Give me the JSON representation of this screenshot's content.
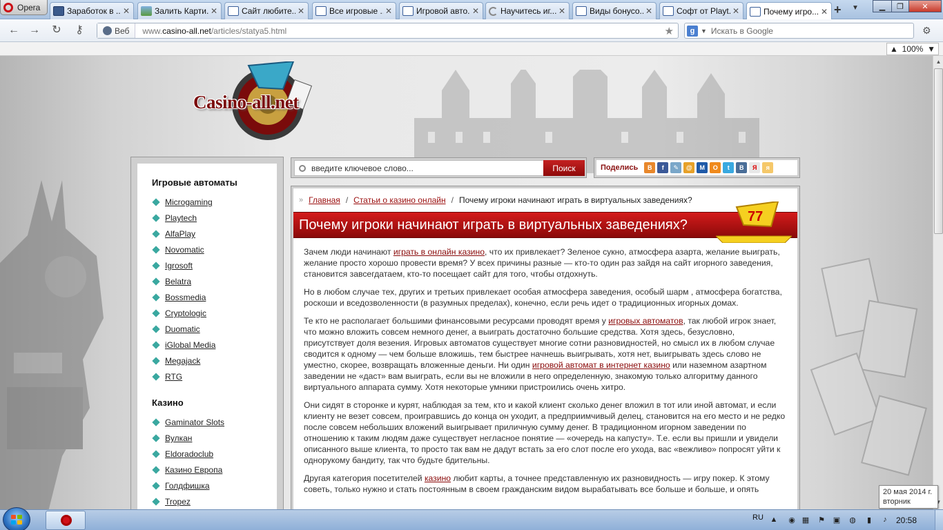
{
  "browser": {
    "menu_label": "Opera",
    "tabs": [
      {
        "title": "Заработок в ...",
        "fav": "mon"
      },
      {
        "title": "Залить Карти...",
        "fav": "img"
      },
      {
        "title": "Сайт любите...",
        "fav": "def"
      },
      {
        "title": "Все игровые ...",
        "fav": "def"
      },
      {
        "title": "Игровой авто...",
        "fav": "def"
      },
      {
        "title": "Научитесь иг...",
        "fav": "spin"
      },
      {
        "title": "Виды бонусо...",
        "fav": "def"
      },
      {
        "title": "Софт от Playt...",
        "fav": "def"
      },
      {
        "title": "Почему игро...",
        "fav": "def",
        "active": true
      }
    ],
    "address": {
      "mode_label": "Веб",
      "url_host": "www.casino-all.net",
      "url_prefix": "www.",
      "url_domain": "casino-all.net",
      "url_path": "/articles/statya5.html"
    },
    "search": {
      "engine_letter": "g",
      "placeholder": "Искать в Google"
    },
    "zoom": "100%"
  },
  "site": {
    "logo_text": "Casino-all.net",
    "search": {
      "placeholder": "введите ключевое слово...",
      "button": "Поиск"
    },
    "share": {
      "label": "Поделись",
      "icons": [
        {
          "name": "blogger-icon",
          "color": "#e8872b",
          "glyph": "B"
        },
        {
          "name": "facebook-icon",
          "color": "#3b5998",
          "glyph": "f"
        },
        {
          "name": "livejournal-icon",
          "color": "#7aa7c9",
          "glyph": "✎"
        },
        {
          "name": "mailru-icon",
          "color": "#e7a128",
          "glyph": "@"
        },
        {
          "name": "moimir-icon",
          "color": "#1f5aa8",
          "glyph": "М"
        },
        {
          "name": "odnoklassniki-icon",
          "color": "#f08a1c",
          "glyph": "О"
        },
        {
          "name": "twitter-icon",
          "color": "#39a9e0",
          "glyph": "t"
        },
        {
          "name": "vkontakte-icon",
          "color": "#4a6e98",
          "glyph": "В"
        },
        {
          "name": "yandex-icon",
          "color": "#e8e8e8",
          "glyph": "Я",
          "fg": "#d00"
        },
        {
          "name": "yaru-icon",
          "color": "#f5c86a",
          "glyph": "я"
        }
      ]
    },
    "sidebar": {
      "heading_slots": "Игровые автоматы",
      "slots": [
        "Microgaming",
        "Playtech",
        "AlfaPlay",
        "Novomatic",
        "Igrosoft",
        "Belatra",
        "Bossmedia",
        "Cryptologic",
        "Duomatic",
        "iGlobal Media",
        "Megajack",
        "RTG"
      ],
      "heading_casino": "Казино",
      "casino": [
        "Gaminator Slots",
        "Вулкан",
        "Eldoradoclub",
        "Казино Европа",
        "Голдфишка",
        "Tropez"
      ]
    },
    "article": {
      "crumbs": {
        "home": "Главная",
        "section": "Статьи о казино онлайн",
        "current": "Почему игроки начинают играть в виртуальных заведениях?"
      },
      "title": "Почему игроки начинают играть в виртуальных заведениях?",
      "p1a": "Зачем люди начинают ",
      "p1link": "играть в онлайн казино",
      "p1b": ", что их привлекает? Зеленое сукно, атмосфера азарта, желание выиграть, желание просто хорошо провести время? У всех причины разные — кто-то один раз зайдя на сайт игорного заведения, становится завсегдатаем, кто-то посещает сайт для того, чтобы отдохнуть.",
      "p2": "Но в любом случае тех, других и третьих привлекает особая атмосфера заведения, особый шарм , атмосфера богатства, роскоши и вседозволенности (в разумных пределах), конечно, если речь идет о традиционных игорных домах.",
      "p3a": "Те кто не располагает большими финансовыми ресурсами проводят время у ",
      "p3link1": "игровых автоматов",
      "p3b": ", так любой игрок знает, что можно вложить совсем немного денег, а выиграть достаточно большие средства. Хотя здесь, безусловно, присутствует доля везения. Игровых автоматов существует многие сотни разновидностей, но смысл их в любом случае сводится к одному — чем больше вложишь, тем быстрее начнешь выигрывать, хотя нет, выигрывать здесь слово не уместно, скорее, возвращать вложенные деньги. Ни один ",
      "p3link2": "игровой автомат в интернет казино",
      "p3c": " или наземном азартном заведении не «даст» вам выиграть, если вы не вложили в него определенную, знакомую только алгоритму данного виртуального аппарата сумму. Хотя некоторые умники пристроились очень хитро.",
      "p4": "Они сидят в сторонке и курят, наблюдая за тем, кто и какой клиент сколько денег вложил в тот или иной автомат, и если клиенту не везет совсем, проигравшись до конца он уходит, а предприимчивый делец, становится на его место и не редко после совсем небольших вложений выигрывает приличную сумму денег. В традиционном игорном заведении по отношению к таким людям даже существует негласное понятие — «очередь на капусту». Т.е. если вы пришли и увидели описанного выше клиента, то просто так вам не дадут встать за его слот после его ухода, вас «вежливо» попросят уйти к однорукому бандиту, так что будьте бдительны.",
      "p5a": "Другая категория посетителей ",
      "p5link": "казино",
      "p5b": " любит карты, а точнее представленную их разновидность — игру покер. К этому советь, только нужно и стать постоянным в своем гражданским видом вырабатывать все больше и больше, и опять"
    }
  },
  "system": {
    "date_tip_line1": "20 мая 2014 г.",
    "date_tip_line2": "вторник",
    "lang": "RU",
    "clock": "20:58"
  }
}
